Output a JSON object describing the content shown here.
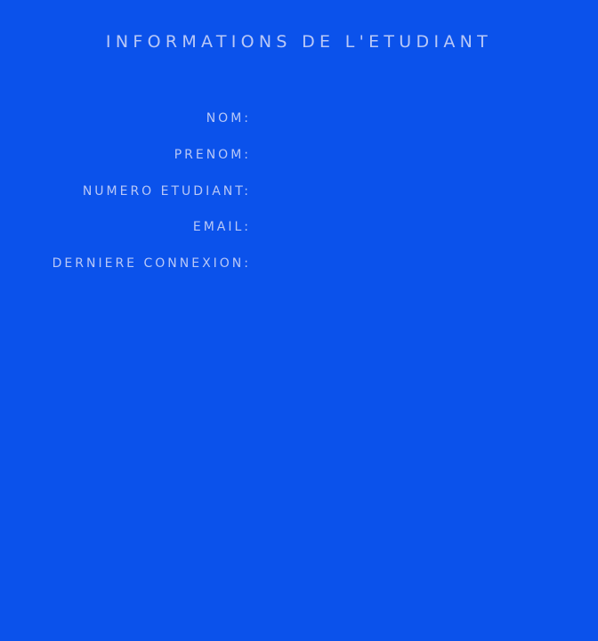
{
  "header": {
    "title": "INFORMATIONS DE L'ETUDIANT"
  },
  "student": {
    "fields": [
      {
        "label": "NOM:",
        "value": ""
      },
      {
        "label": "PRENOM:",
        "value": ""
      },
      {
        "label": "NUMERO ETUDIANT:",
        "value": ""
      },
      {
        "label": "EMAIL:",
        "value": ""
      },
      {
        "label": "DERNIERE CONNEXION:",
        "value": ""
      }
    ]
  },
  "colors": {
    "background": "#0b52eb",
    "text": "#b9c8f7"
  }
}
